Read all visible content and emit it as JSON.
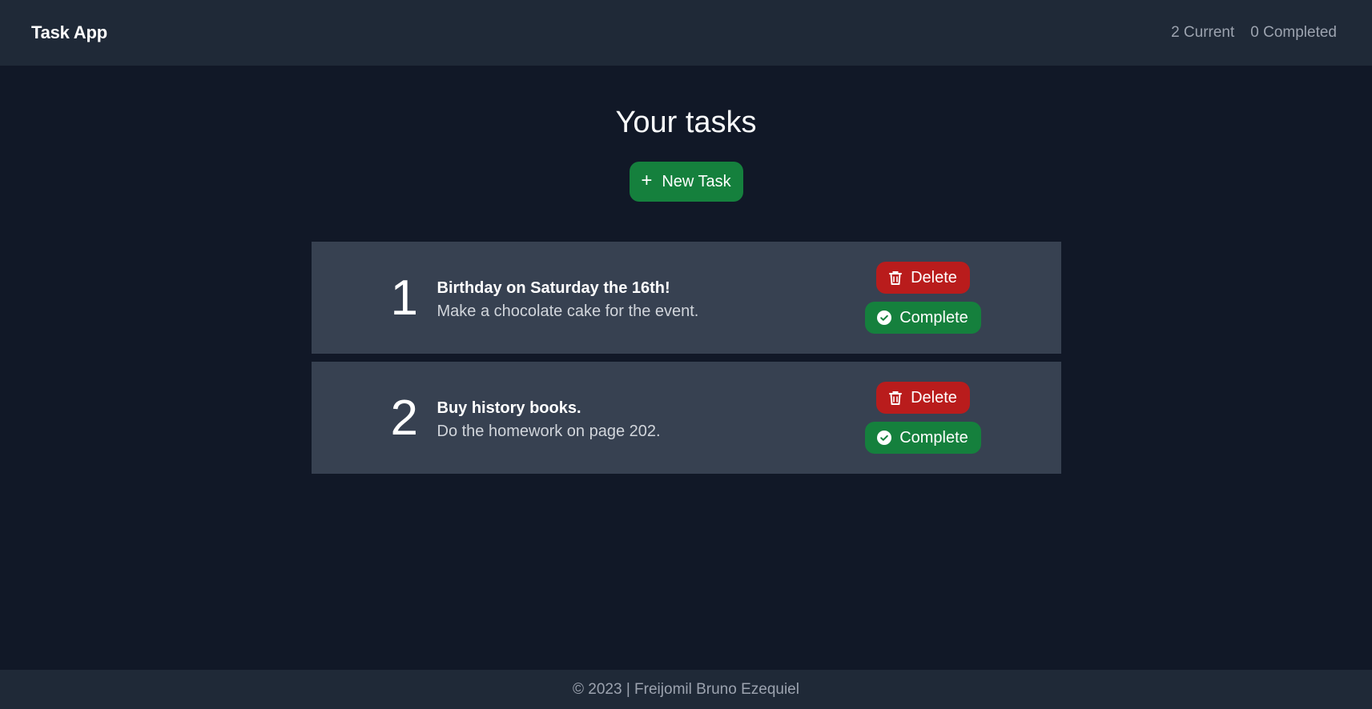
{
  "navbar": {
    "brand": "Task App",
    "current_count": "2 Current",
    "completed_count": "0 Completed"
  },
  "main": {
    "title": "Your tasks",
    "new_task_label": "New Task"
  },
  "tasks": [
    {
      "number": "1",
      "title": "Birthday on Saturday the 16th!",
      "description": "Make a chocolate cake for the event.",
      "delete_label": "Delete",
      "complete_label": "Complete"
    },
    {
      "number": "2",
      "title": "Buy history books.",
      "description": "Do the homework on page 202.",
      "delete_label": "Delete",
      "complete_label": "Complete"
    }
  ],
  "footer": {
    "text": "© 2023 | Freijomil Bruno Ezequiel"
  },
  "colors": {
    "background": "#111827",
    "navbar": "#1f2937",
    "card": "#374151",
    "green": "#15803d",
    "red": "#b91c1c"
  },
  "icons": {
    "new_task": "plus-icon",
    "delete": "trash-icon",
    "complete": "check-circle-icon"
  }
}
